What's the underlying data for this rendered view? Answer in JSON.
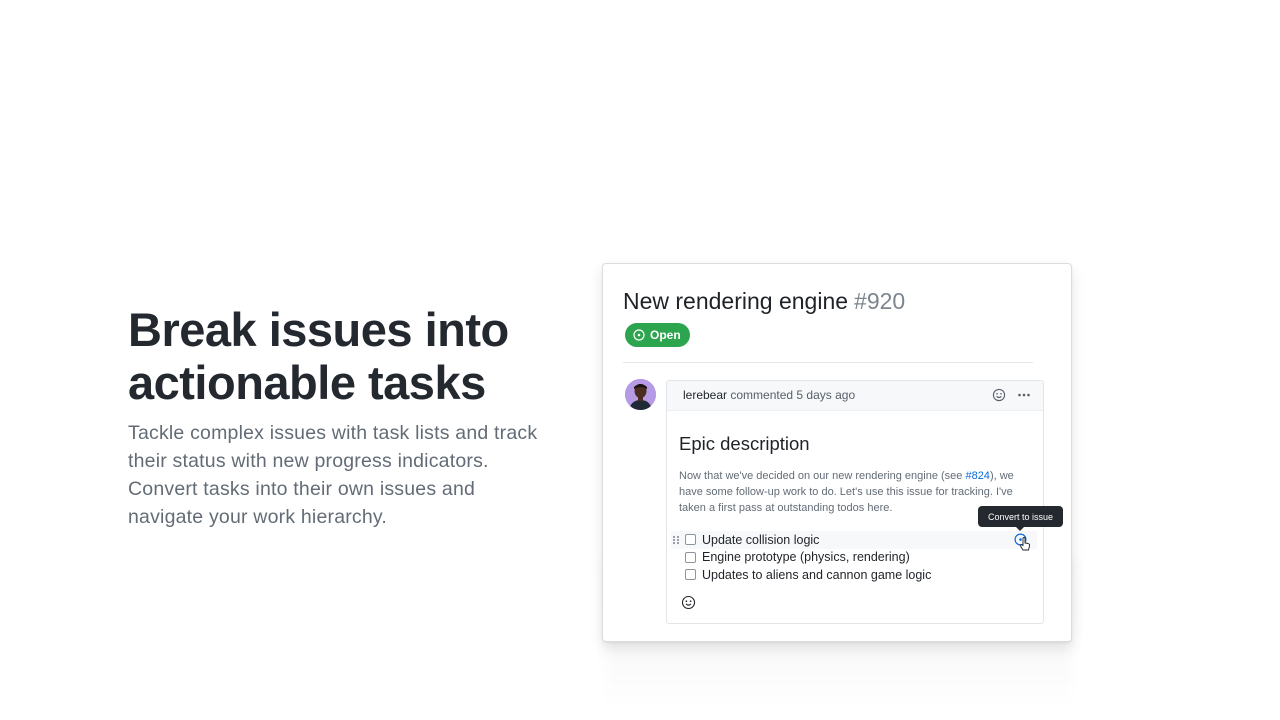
{
  "hero": {
    "title": "Break issues into actionable tasks",
    "description": "Tackle complex issues with task lists and track their status with new progress indicators. Convert tasks into their own issues and navigate your work hierarchy."
  },
  "issue": {
    "title": "New rendering engine",
    "number": "#920",
    "state": "Open"
  },
  "comment": {
    "author": "lerebear",
    "meta": "commented 5 days ago",
    "heading": "Epic description",
    "body_before_link": "Now that we've decided on our new rendering engine (see ",
    "link_text": "#824",
    "body_after_link": "), we have some follow-up work to do. Let's use this issue for tracking. I've taken a first pass at outstanding todos here."
  },
  "tasks": [
    {
      "label": "Update collision logic",
      "checked": false
    },
    {
      "label": "Engine prototype (physics, rendering)",
      "checked": false
    },
    {
      "label": "Updates to aliens and cannon game logic",
      "checked": false
    }
  ],
  "tooltip": {
    "label": "Convert to issue"
  },
  "icons": {
    "state": "issue-opened-icon",
    "header_reaction": "smiley-icon",
    "header_menu": "kebab-horizontal-icon",
    "drag": "grabber-icon",
    "convert": "issue-opened-icon",
    "cursor": "hand-pointer-icon",
    "reaction": "smiley-icon"
  },
  "colors": {
    "open_green": "#2da44e",
    "link_blue": "#0969da",
    "tooltip_bg": "#24292f"
  }
}
